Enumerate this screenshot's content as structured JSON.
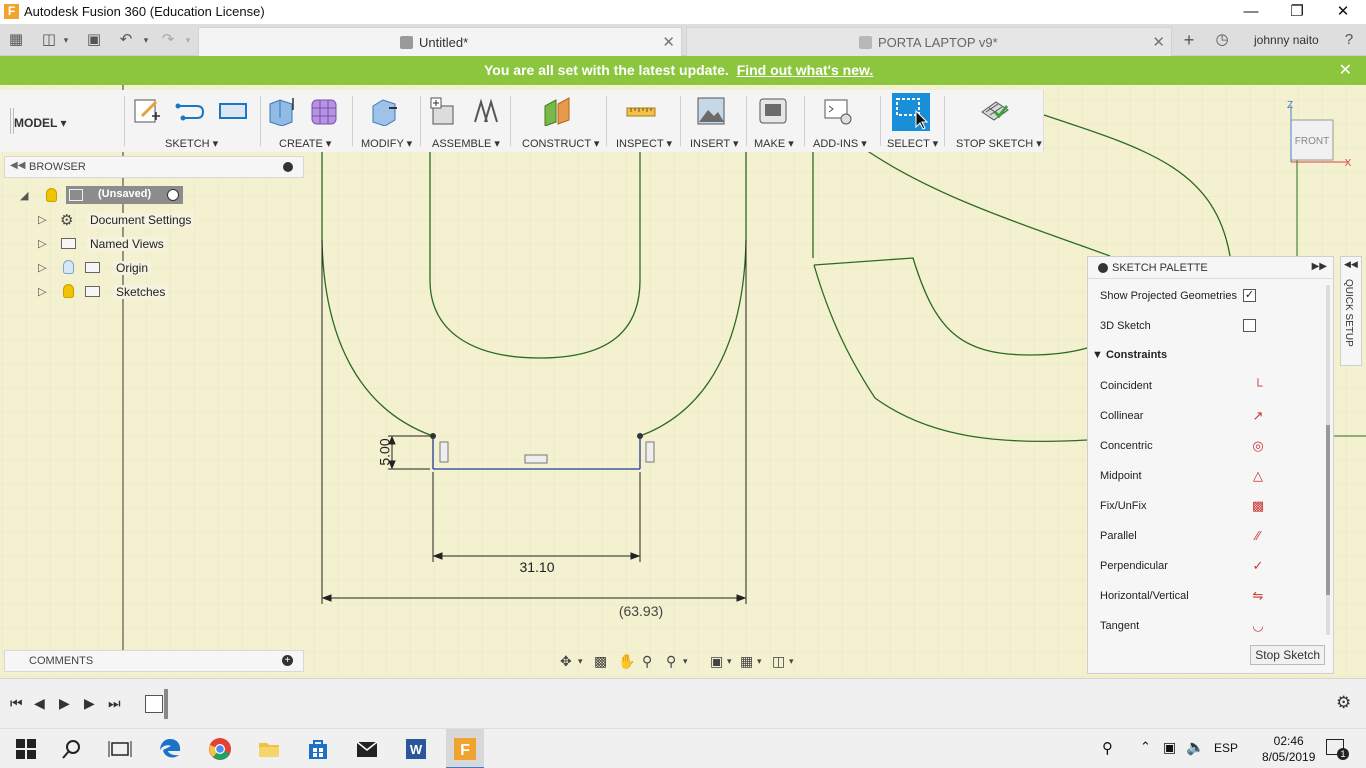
{
  "window": {
    "title": "Autodesk Fusion 360 (Education License)",
    "app_letter": "F"
  },
  "tabs": [
    {
      "label": "Untitled*",
      "active": true
    },
    {
      "label": "PORTA LAPTOP v9*",
      "active": false
    }
  ],
  "user": {
    "name": "johnny naito"
  },
  "banner": {
    "message": "You are all set with the latest update.",
    "link": "Find out what's new."
  },
  "toolbar": {
    "workspace": "MODEL",
    "groups": [
      {
        "label": "SKETCH ▾"
      },
      {
        "label": "CREATE ▾"
      },
      {
        "label": "MODIFY ▾"
      },
      {
        "label": "ASSEMBLE ▾"
      },
      {
        "label": "CONSTRUCT ▾"
      },
      {
        "label": "INSPECT ▾"
      },
      {
        "label": "INSERT ▾"
      },
      {
        "label": "MAKE ▾"
      },
      {
        "label": "ADD-INS ▾"
      },
      {
        "label": "SELECT ▾"
      },
      {
        "label": "STOP SKETCH ▾"
      }
    ]
  },
  "browser": {
    "title": "BROWSER",
    "root": "(Unsaved)",
    "items": [
      {
        "label": "Document Settings"
      },
      {
        "label": "Named Views"
      },
      {
        "label": "Origin"
      },
      {
        "label": "Sketches"
      }
    ]
  },
  "comments": {
    "title": "COMMENTS"
  },
  "viewcube": {
    "face": "FRONT",
    "z": "Z",
    "x": "X"
  },
  "dimensions": {
    "height": "5.00",
    "width": "31.10",
    "overall": "(63.93)"
  },
  "palette": {
    "title": "SKETCH PALETTE",
    "options": [
      {
        "label": "Show Projected Geometries",
        "checked": true
      },
      {
        "label": "3D Sketch",
        "checked": false
      }
    ],
    "constraints_title": "Constraints",
    "constraints": [
      {
        "label": "Coincident",
        "icon": "coincident-icon"
      },
      {
        "label": "Collinear",
        "icon": "collinear-icon"
      },
      {
        "label": "Concentric",
        "icon": "concentric-icon"
      },
      {
        "label": "Midpoint",
        "icon": "midpoint-icon"
      },
      {
        "label": "Fix/UnFix",
        "icon": "lock-icon"
      },
      {
        "label": "Parallel",
        "icon": "parallel-icon"
      },
      {
        "label": "Perpendicular",
        "icon": "perpendicular-icon"
      },
      {
        "label": "Horizontal/Vertical",
        "icon": "horizontal-vertical-icon"
      },
      {
        "label": "Tangent",
        "icon": "tangent-icon"
      }
    ],
    "stop_button": "Stop Sketch"
  },
  "quick_setup": {
    "label": "QUICK SETUP"
  },
  "taskbar": {
    "language": "ESP",
    "time": "02:46",
    "date": "8/05/2019",
    "notifications": "1"
  }
}
